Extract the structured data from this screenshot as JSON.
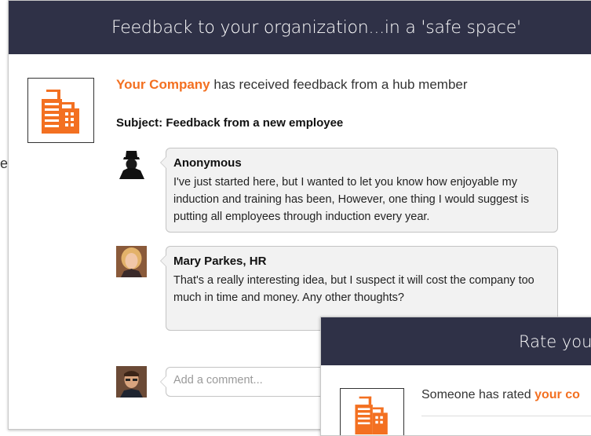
{
  "stray_letter": "e",
  "main_card": {
    "title": "Feedback to your organization...in a 'safe space'",
    "company_name": "Your Company",
    "headline_rest": " has received feedback from a hub member",
    "subject": "Subject: Feedback from a new employee",
    "comments": [
      {
        "author": "Anonymous",
        "text": "I've just started here, but I wanted to let you know how enjoyable my induction and training has been,  However, one thing I would suggest is putting all employees through induction every year."
      },
      {
        "author": "Mary Parkes, HR",
        "text": "That's a really interesting idea, but I suspect it will cost the company too much in time and money. Any other thoughts?"
      }
    ],
    "comment_placeholder": "Add a comment..."
  },
  "second_card": {
    "title": "Rate your",
    "text_prefix": "Someone has rated ",
    "text_company": "your co"
  },
  "colors": {
    "header_bg": "#2f3147",
    "accent": "#f37021",
    "bubble_bg": "#f2f2f2"
  },
  "icons": [
    "building-icon",
    "anonymous-avatar",
    "user-avatar"
  ]
}
